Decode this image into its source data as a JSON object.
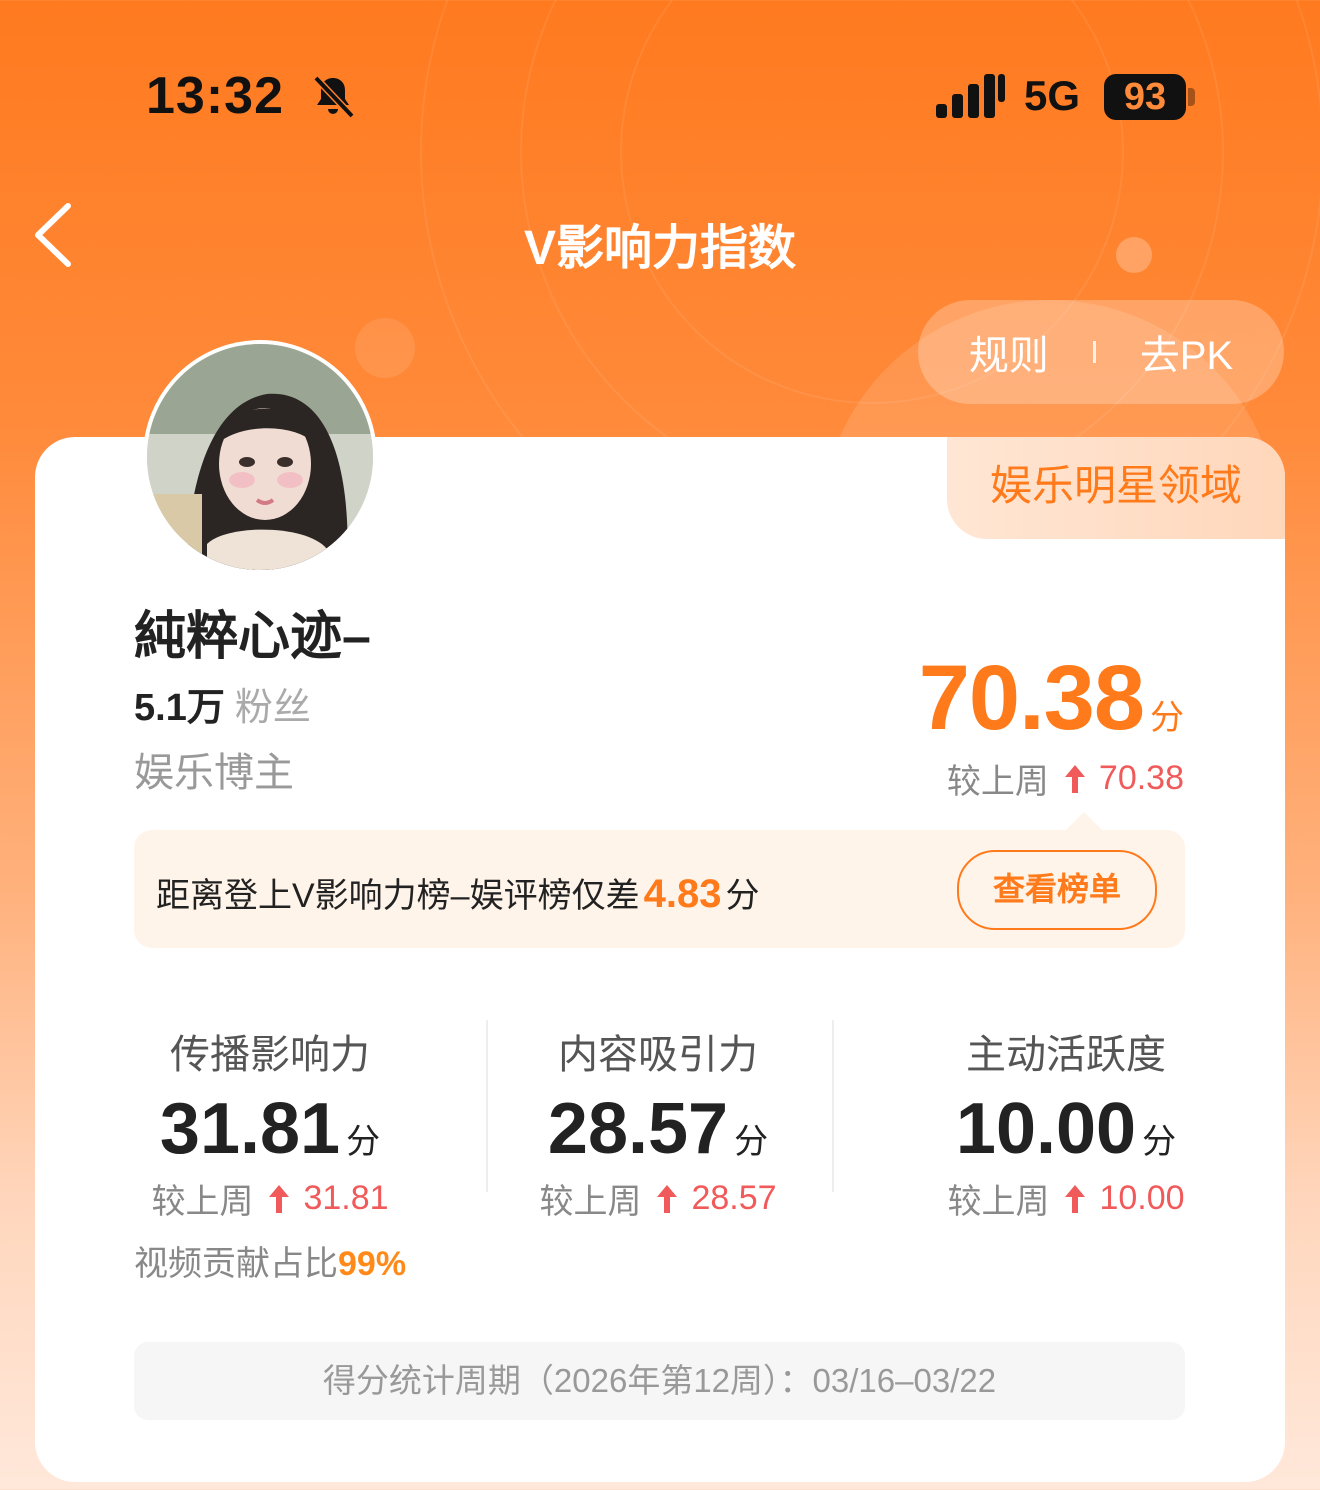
{
  "status_bar": {
    "time": "13:32",
    "network": "5G",
    "battery": "93",
    "icons": [
      "bell-muted-icon",
      "signal-icon"
    ]
  },
  "header": {
    "title": "V影响力指数",
    "rules_label": "规则",
    "pk_label": "去PK"
  },
  "profile": {
    "domain_tag": "娱乐明星领域",
    "name": "純粹心迹–",
    "fans_count": "5.1万",
    "fans_label": "粉丝",
    "role": "娱乐博主"
  },
  "score": {
    "value": "70.38",
    "unit": "分",
    "delta_label": "较上周",
    "delta_value": "70.38"
  },
  "notice": {
    "text": "距离登上V影响力榜–娱评榜仅差",
    "gap_value": "4.83",
    "unit": "分",
    "button": "查看榜单"
  },
  "metrics": [
    {
      "label": "传播影响力",
      "value": "31.81",
      "unit": "分",
      "delta_label": "较上周",
      "delta_value": "31.81"
    },
    {
      "label": "内容吸引力",
      "value": "28.57",
      "unit": "分",
      "delta_label": "较上周",
      "delta_value": "28.57"
    },
    {
      "label": "主动活跃度",
      "value": "10.00",
      "unit": "分",
      "delta_label": "较上周",
      "delta_value": "10.00"
    }
  ],
  "contribution": {
    "label": "视频贡献占比",
    "value": "99%"
  },
  "period": "得分统计周期（2026年第12周）：03/16–03/22",
  "colors": {
    "accent": "#ff7a1a",
    "up": "#f05a5a"
  }
}
